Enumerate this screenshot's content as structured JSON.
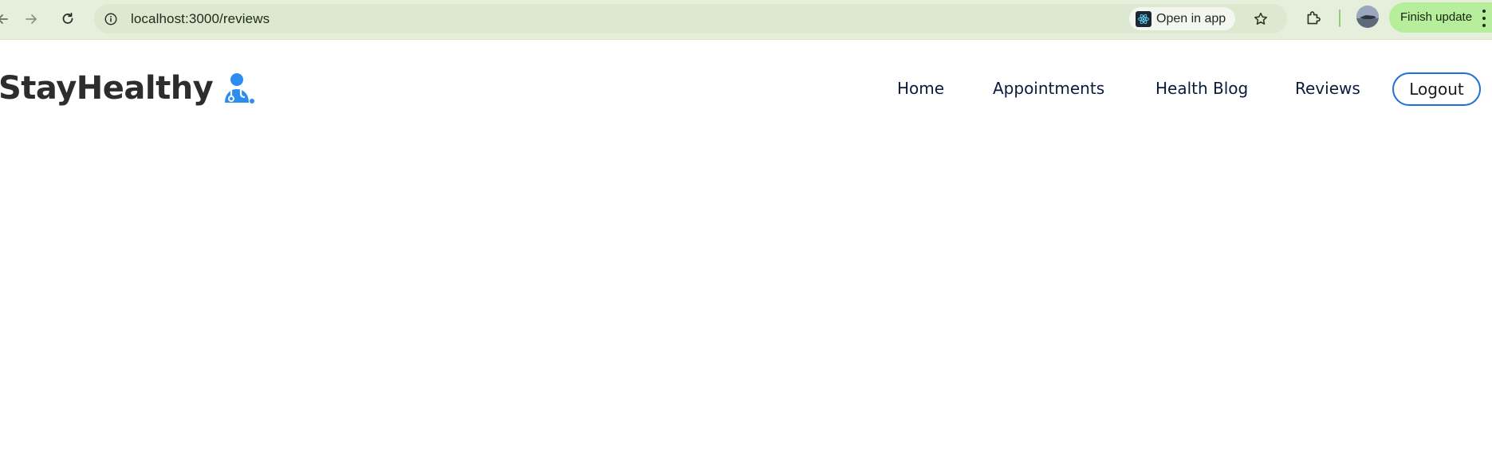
{
  "browser": {
    "url": "localhost:3000/reviews",
    "open_in_app_label": "Open in app",
    "finish_update_label": "Finish update",
    "icons": [
      "back-icon",
      "forward-icon",
      "reload-icon",
      "site-info-icon",
      "react-app-icon",
      "star-icon",
      "extensions-icon",
      "profile-avatar",
      "more-menu-icon"
    ],
    "accent_colors": {
      "toolbar_bg": "#e6eedc",
      "update_button": "#b6ee9c"
    }
  },
  "site": {
    "brand_name": "StayHealthy",
    "brand_icon": "doctor-icon",
    "brand_color": "#2d8cf0",
    "nav": {
      "home": "Home",
      "appointments": "Appointments",
      "health_blog": "Health Blog",
      "reviews": "Reviews"
    },
    "logout_label": "Logout",
    "logout_border_color": "#1f6fd8"
  }
}
